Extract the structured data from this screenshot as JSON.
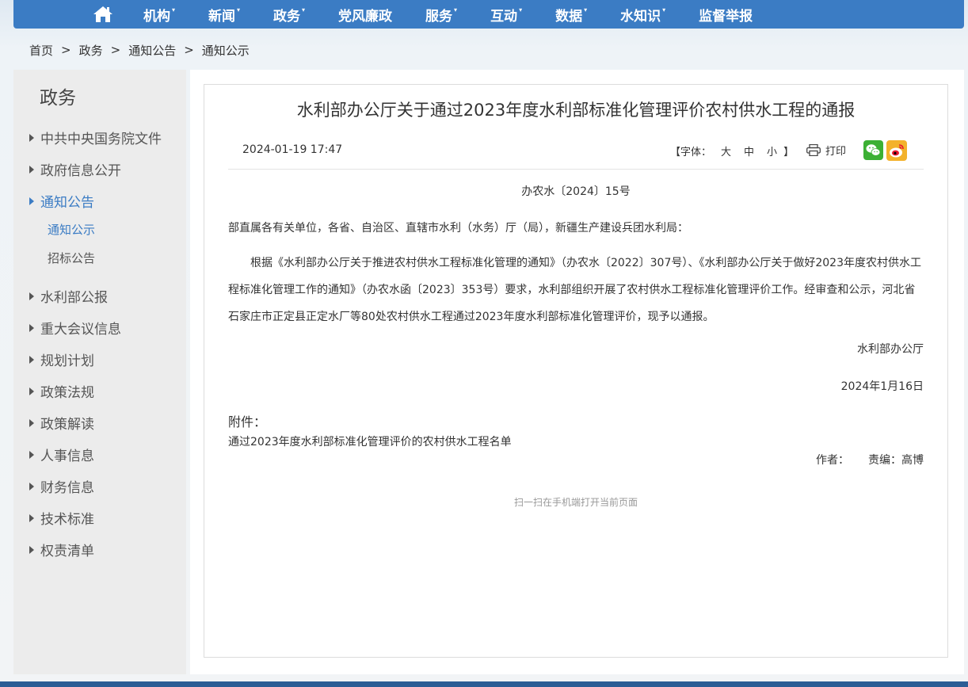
{
  "nav": {
    "items": [
      {
        "label": "机构",
        "caret": "▾"
      },
      {
        "label": "新闻",
        "caret": "▾"
      },
      {
        "label": "政务",
        "caret": "▾"
      },
      {
        "label": "党风廉政",
        "caret": ""
      },
      {
        "label": "服务",
        "caret": "▾"
      },
      {
        "label": "互动",
        "caret": "▾"
      },
      {
        "label": "数据",
        "caret": "▾"
      },
      {
        "label": "水知识",
        "caret": "▾"
      },
      {
        "label": "监督举报",
        "caret": ""
      }
    ]
  },
  "breadcrumb": {
    "items": [
      "首页",
      "政务",
      "通知公告",
      "通知公示"
    ],
    "separator": ">"
  },
  "sidebar": {
    "title": "政务",
    "items": [
      "中共中央国务院文件",
      "政府信息公开",
      "通知公告",
      "水利部公报",
      "重大会议信息",
      "规划计划",
      "政策法规",
      "政策解读",
      "人事信息",
      "财务信息",
      "技术标准",
      "权责清单"
    ],
    "sub_items": [
      "通知公示",
      "招标公告"
    ]
  },
  "article": {
    "title": "水利部办公厅关于通过2023年度水利部标准化管理评价农村供水工程的通报",
    "date": "2024-01-19 17:47",
    "font_ctl": {
      "open": "【字体：",
      "large": "大",
      "medium": "中",
      "small": "小",
      "close": "】"
    },
    "print_label": "打印",
    "doc_no": "办农水〔2024〕15号",
    "salutation": "部直属各有关单位，各省、自治区、直辖市水利（水务）厅（局），新疆生产建设兵团水利局：",
    "body": "根据《水利部办公厅关于推进农村供水工程标准化管理的通知》（办农水〔2022〕307号）、《水利部办公厅关于做好2023年度农村供水工程标准化管理工作的通知》（办农水函〔2023〕353号）要求，水利部组织开展了农村供水工程标准化管理评价工作。经审查和公示，河北省石家庄市正定县正定水厂等80处农村供水工程通过2023年度水利部标准化管理评价，现予以通报。",
    "sign_org": "水利部办公厅",
    "sign_date": "2024年1月16日",
    "attach_label": "附件：",
    "attach_link": "通过2023年度水利部标准化管理评价的农村供水工程名单",
    "author_label": "作者：",
    "editor_label": "责编：",
    "editor_name": "高博",
    "qr_hint": "扫一扫在手机端打开当前页面"
  },
  "colors": {
    "nav_bg": "#3b7cc4",
    "active": "#3b7cc4",
    "wechat": "#3cb034",
    "weibo": "#f3b22b"
  }
}
